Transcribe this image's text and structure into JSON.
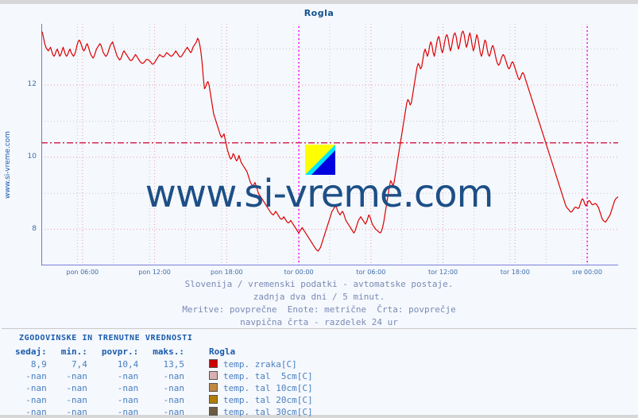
{
  "page": {
    "station": "Rogla",
    "watermark_text": "www.si-vreme.com",
    "sidebar_text": "www.si-vreme.com"
  },
  "caption": {
    "line1": "Slovenija / vremenski podatki - avtomatske postaje.",
    "line2": "zadnja dva dni / 5 minut.",
    "line3": "Meritve: povprečne  Enote: metrične  Črta: povprečje",
    "line4": "navpična črta - razdelek 24 ur"
  },
  "table": {
    "title": "ZGODOVINSKE IN TRENUTNE VREDNOSTI",
    "headers": [
      "sedaj:",
      "min.:",
      "povpr.:",
      "maks.:",
      "Rogla"
    ],
    "rows": [
      {
        "sedaj": "8,9",
        "min": "7,4",
        "povpr": "10,4",
        "maks": "13,5",
        "label": "temp. zraka[C]",
        "color": "#cc0000"
      },
      {
        "sedaj": "-nan",
        "min": "-nan",
        "povpr": "-nan",
        "maks": "-nan",
        "label": "temp. tal  5cm[C]",
        "color": "#d8b0b0"
      },
      {
        "sedaj": "-nan",
        "min": "-nan",
        "povpr": "-nan",
        "maks": "-nan",
        "label": "temp. tal 10cm[C]",
        "color": "#c08840"
      },
      {
        "sedaj": "-nan",
        "min": "-nan",
        "povpr": "-nan",
        "maks": "-nan",
        "label": "temp. tal 20cm[C]",
        "color": "#b07d06"
      },
      {
        "sedaj": "-nan",
        "min": "-nan",
        "povpr": "-nan",
        "maks": "-nan",
        "label": "temp. tal 30cm[C]",
        "color": "#6b5b40"
      }
    ]
  },
  "chart_data": {
    "type": "line",
    "title": "Rogla",
    "xlabel": "",
    "ylabel": "",
    "ylim": [
      7.0,
      13.7
    ],
    "yticks": [
      8,
      10,
      12
    ],
    "ytick_labels": [
      "8",
      "10",
      "12"
    ],
    "xtick_labels": [
      "pon 06:00",
      "pon 12:00",
      "pon 18:00",
      "tor 00:00",
      "tor 06:00",
      "tor 12:00",
      "tor 18:00",
      "sre 00:00"
    ],
    "xtick_positions": [
      0.0714,
      0.1964,
      0.3214,
      0.4464,
      0.5714,
      0.6964,
      0.8214,
      0.9464
    ],
    "grid": true,
    "legend_position": "bottom-table",
    "average_line": {
      "value": 10.4,
      "color": "#cc0033",
      "style": "dash-dot"
    },
    "day_markers": {
      "positions": [
        0.4464,
        0.9464
      ],
      "color": "#ff00ff",
      "style": "dotted"
    },
    "series": [
      {
        "name": "temp. zraka[C]",
        "color": "#dd0000",
        "current": 8.9,
        "min": 7.4,
        "avg": 10.4,
        "max": 13.5,
        "values": [
          13.5,
          13.45,
          13.3,
          13.15,
          13.05,
          13.0,
          12.95,
          13.0,
          13.05,
          12.95,
          12.85,
          12.8,
          12.85,
          12.95,
          13.0,
          12.9,
          12.8,
          12.85,
          12.95,
          13.05,
          12.95,
          12.85,
          12.8,
          12.85,
          12.95,
          13.0,
          12.9,
          12.85,
          12.8,
          12.85,
          12.95,
          13.1,
          13.2,
          13.25,
          13.2,
          13.1,
          13.0,
          12.95,
          13.0,
          13.1,
          13.15,
          13.05,
          12.95,
          12.85,
          12.8,
          12.75,
          12.8,
          12.9,
          13.0,
          13.05,
          13.1,
          13.15,
          13.1,
          13.0,
          12.9,
          12.85,
          12.8,
          12.82,
          12.9,
          13.0,
          13.1,
          13.15,
          13.2,
          13.1,
          13.0,
          12.9,
          12.8,
          12.75,
          12.7,
          12.72,
          12.8,
          12.9,
          12.95,
          12.9,
          12.85,
          12.8,
          12.75,
          12.7,
          12.68,
          12.7,
          12.75,
          12.8,
          12.85,
          12.8,
          12.75,
          12.7,
          12.65,
          12.62,
          12.6,
          12.62,
          12.65,
          12.7,
          12.72,
          12.7,
          12.68,
          12.65,
          12.6,
          12.58,
          12.6,
          12.65,
          12.7,
          12.75,
          12.8,
          12.85,
          12.82,
          12.8,
          12.78,
          12.8,
          12.85,
          12.9,
          12.88,
          12.85,
          12.82,
          12.8,
          12.82,
          12.85,
          12.9,
          12.95,
          12.9,
          12.85,
          12.8,
          12.78,
          12.8,
          12.85,
          12.9,
          12.95,
          13.0,
          13.05,
          13.0,
          12.95,
          12.9,
          12.95,
          13.05,
          13.1,
          13.15,
          13.2,
          13.3,
          13.25,
          13.1,
          12.9,
          12.6,
          12.2,
          11.9,
          11.95,
          12.05,
          12.1,
          12.0,
          11.8,
          11.6,
          11.4,
          11.2,
          11.1,
          11.0,
          10.9,
          10.8,
          10.7,
          10.6,
          10.55,
          10.6,
          10.65,
          10.5,
          10.35,
          10.2,
          10.1,
          10.0,
          9.95,
          10.0,
          10.1,
          10.05,
          9.95,
          9.9,
          9.95,
          10.05,
          9.95,
          9.85,
          9.8,
          9.75,
          9.7,
          9.65,
          9.6,
          9.5,
          9.4,
          9.3,
          9.25,
          9.2,
          9.25,
          9.3,
          9.2,
          9.1,
          9.0,
          8.95,
          8.9,
          8.85,
          8.8,
          8.75,
          8.7,
          8.65,
          8.6,
          8.55,
          8.5,
          8.45,
          8.42,
          8.4,
          8.45,
          8.5,
          8.45,
          8.4,
          8.35,
          8.3,
          8.28,
          8.3,
          8.35,
          8.3,
          8.25,
          8.2,
          8.18,
          8.2,
          8.25,
          8.2,
          8.15,
          8.1,
          8.05,
          8.0,
          7.95,
          7.9,
          7.95,
          8.0,
          8.05,
          8.0,
          7.95,
          7.9,
          7.85,
          7.8,
          7.75,
          7.7,
          7.65,
          7.6,
          7.55,
          7.5,
          7.45,
          7.42,
          7.4,
          7.45,
          7.5,
          7.6,
          7.7,
          7.8,
          7.9,
          8.0,
          8.1,
          8.2,
          8.3,
          8.4,
          8.5,
          8.55,
          8.6,
          8.65,
          8.6,
          8.5,
          8.45,
          8.4,
          8.45,
          8.5,
          8.45,
          8.35,
          8.25,
          8.2,
          8.15,
          8.1,
          8.05,
          8.0,
          7.95,
          7.9,
          7.95,
          8.05,
          8.15,
          8.25,
          8.3,
          8.35,
          8.3,
          8.25,
          8.2,
          8.15,
          8.2,
          8.3,
          8.4,
          8.35,
          8.25,
          8.15,
          8.1,
          8.05,
          8.0,
          7.98,
          7.95,
          7.92,
          7.9,
          7.95,
          8.05,
          8.2,
          8.4,
          8.6,
          8.8,
          9.0,
          9.2,
          9.35,
          9.3,
          9.2,
          9.3,
          9.5,
          9.7,
          9.9,
          10.1,
          10.3,
          10.5,
          10.7,
          10.9,
          11.1,
          11.3,
          11.5,
          11.6,
          11.55,
          11.45,
          11.5,
          11.7,
          11.9,
          12.1,
          12.3,
          12.5,
          12.6,
          12.55,
          12.45,
          12.5,
          12.7,
          12.9,
          13.0,
          12.9,
          12.8,
          12.9,
          13.1,
          13.2,
          13.1,
          12.9,
          12.8,
          12.95,
          13.15,
          13.3,
          13.35,
          13.2,
          13.0,
          12.9,
          13.0,
          13.2,
          13.35,
          13.4,
          13.3,
          13.1,
          12.95,
          13.05,
          13.25,
          13.4,
          13.45,
          13.35,
          13.15,
          13.0,
          13.1,
          13.3,
          13.45,
          13.5,
          13.4,
          13.2,
          13.05,
          13.15,
          13.35,
          13.45,
          13.3,
          13.1,
          12.95,
          13.05,
          13.25,
          13.4,
          13.3,
          13.1,
          12.9,
          12.8,
          12.9,
          13.1,
          13.25,
          13.2,
          13.0,
          12.85,
          12.8,
          12.9,
          13.05,
          13.1,
          13.0,
          12.85,
          12.7,
          12.6,
          12.55,
          12.6,
          12.7,
          12.8,
          12.85,
          12.8,
          12.7,
          12.6,
          12.5,
          12.45,
          12.5,
          12.6,
          12.65,
          12.6,
          12.5,
          12.4,
          12.3,
          12.2,
          12.15,
          12.2,
          12.3,
          12.35,
          12.3,
          12.2,
          12.1,
          12.0,
          11.9,
          11.8,
          11.7,
          11.6,
          11.5,
          11.4,
          11.3,
          11.2,
          11.1,
          11.0,
          10.9,
          10.8,
          10.7,
          10.6,
          10.5,
          10.4,
          10.3,
          10.2,
          10.1,
          10.0,
          9.9,
          9.8,
          9.7,
          9.6,
          9.5,
          9.4,
          9.3,
          9.2,
          9.1,
          9.0,
          8.9,
          8.8,
          8.7,
          8.62,
          8.58,
          8.55,
          8.5,
          8.48,
          8.5,
          8.55,
          8.6,
          8.62,
          8.6,
          8.58,
          8.6,
          8.7,
          8.8,
          8.85,
          8.8,
          8.7,
          8.65,
          8.7,
          8.78,
          8.8,
          8.75,
          8.7,
          8.68,
          8.7,
          8.72,
          8.7,
          8.65,
          8.6,
          8.5,
          8.4,
          8.3,
          8.25,
          8.22,
          8.2,
          8.25,
          8.3,
          8.35,
          8.4,
          8.5,
          8.6,
          8.7,
          8.8,
          8.85,
          8.88,
          8.9
        ]
      }
    ]
  }
}
